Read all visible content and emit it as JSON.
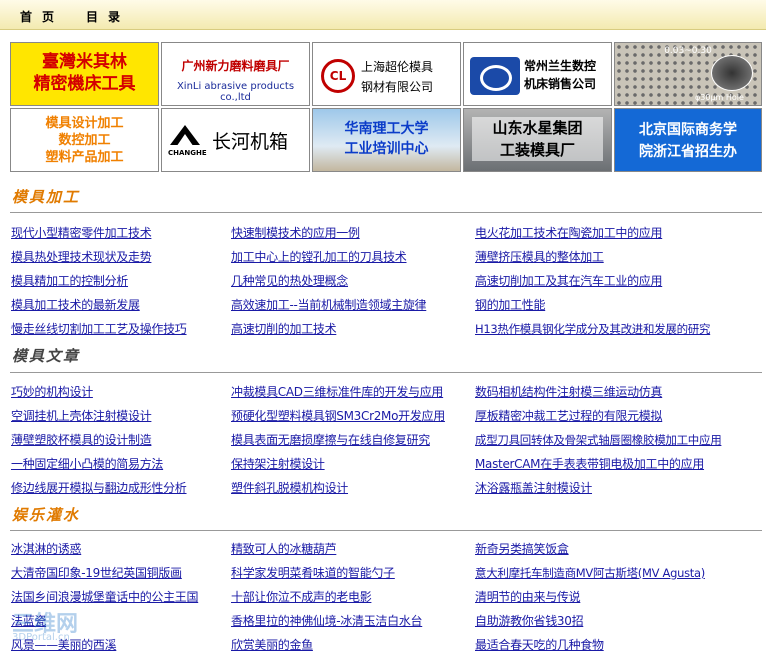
{
  "nav": {
    "home": "首页",
    "catalog": "目录"
  },
  "banners": {
    "b1": [
      "臺灣米其林",
      "精密機床工具"
    ],
    "b2": [
      "广州新力磨料磨具厂",
      "XinLi abrasive products co.,ltd"
    ],
    "b3": {
      "logo": "CL",
      "lines": [
        "上海超伦模具",
        "钢材有限公司"
      ]
    },
    "b4": [
      "常州兰生数控",
      "机床销售公司"
    ],
    "b5": {
      "top": "0.03~0.30",
      "bottom": "φ30μm Hole"
    },
    "b6": [
      "模具设计加工",
      "数控加工",
      "塑料产品加工"
    ],
    "b7": {
      "small": "CHANGHE",
      "name": "长河机箱"
    },
    "b8": [
      "华南理工大学",
      "工业培训中心"
    ],
    "b9": [
      "山东水星集团",
      "工装模具厂"
    ],
    "b10": [
      "北京国际商务学",
      "院浙江省招生办"
    ]
  },
  "sections": [
    {
      "title": "模具加工",
      "cols": [
        [
          "现代小型精密零件加工技术",
          "模具热处理技术现状及走势",
          "模具精加工的控制分析",
          "模具加工技术的最新发展",
          "慢走丝线切割加工工艺及操作技巧"
        ],
        [
          "快速制模技术的应用一例",
          "加工中心上的镗孔加工的刀具技术",
          "几种常见的热处理概念",
          "高效速加工--当前机械制造领域主旋律",
          "高速切削的加工技术"
        ],
        [
          "电火花加工技术在陶瓷加工中的应用",
          "薄壁挤压模具的整体加工",
          "高速切削加工及其在汽车工业的应用",
          "钢的加工性能",
          "H13热作模具钢化学成分及其改进和发展的研究"
        ]
      ]
    },
    {
      "title": "模具文章",
      "cols": [
        [
          "巧妙的机构设计",
          "空调挂机上壳体注射模设计",
          "薄壁塑胶杯模具的设计制造",
          "一种固定细小凸模的简易方法",
          "修边线展开模拟与翻边成形性分析"
        ],
        [
          "冲裁模具CAD三维标准件库的开发与应用",
          "预硬化型塑料模具钢SM3Cr2Mo开发应用",
          "模具表面无磨损摩擦与在线自修复研究",
          "保持架注射模设计",
          "塑件斜孔脱模机构设计"
        ],
        [
          "数码相机结构件注射模三维运动仿真",
          "厚板精密冲裁工艺过程的有限元模拟",
          "成型刀具回转体及骨架式轴唇圈橡胶模加工中应用",
          "MasterCAM在手表表带铜电极加工中的应用",
          "沐浴露瓶盖注射模设计"
        ]
      ]
    },
    {
      "title": "娱乐灌水",
      "cols": [
        [
          "冰淇淋的诱惑",
          "大清帝国印象-19世纪英国铜版画",
          "法国乡间浪漫城堡童话中的公主王国",
          "法蓝瓷",
          "风景——美丽的西溪"
        ],
        [
          "精致可人的冰糖葫芦",
          "科学家发明菜肴味道的智能勺子",
          "十部让你泣不成声的老电影",
          "香格里拉的神佛仙境-冰清玉洁白水台",
          "欣赏美丽的金鱼"
        ],
        [
          "新奇另类搞笑饭盒",
          "意大利摩托车制造商MV阿古斯塔(MV Agusta)",
          "清明节的由来与传说",
          "自助游教你省钱30招",
          "最适合春天吃的几种食物"
        ]
      ]
    }
  ],
  "watermark": {
    "main": "三维网",
    "sub": "3DPortal.cn"
  }
}
